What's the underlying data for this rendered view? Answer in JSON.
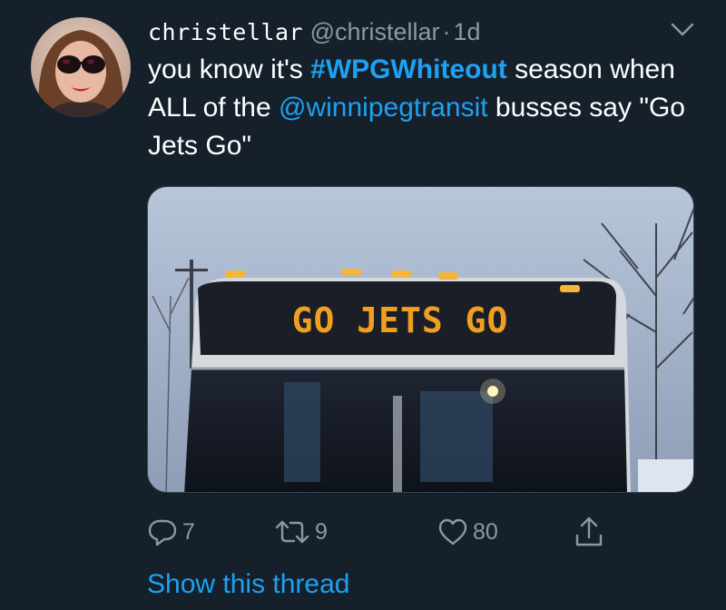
{
  "tweet": {
    "display_name": "christellar",
    "handle": "@christellar",
    "separator": "·",
    "time": "1d",
    "text": {
      "part1": "you know it's ",
      "hashtag": "#WPGWhiteout",
      "part2": " season when ALL of the ",
      "mention": "@winnipegtransit",
      "part3": " busses say \"Go Jets Go\""
    },
    "media": {
      "sign_text": "GO JETS GO"
    }
  },
  "actions": {
    "reply": {
      "icon": "reply-icon",
      "count": "7"
    },
    "retweet": {
      "icon": "retweet-icon",
      "count": "9"
    },
    "like": {
      "icon": "heart-icon",
      "count": "80"
    },
    "share": {
      "icon": "share-icon"
    }
  },
  "show_thread": "Show this thread",
  "colors": {
    "background": "#15202b",
    "accent": "#1da1f2",
    "secondary_text": "#8899a6",
    "sign_led": "#f0a020"
  }
}
